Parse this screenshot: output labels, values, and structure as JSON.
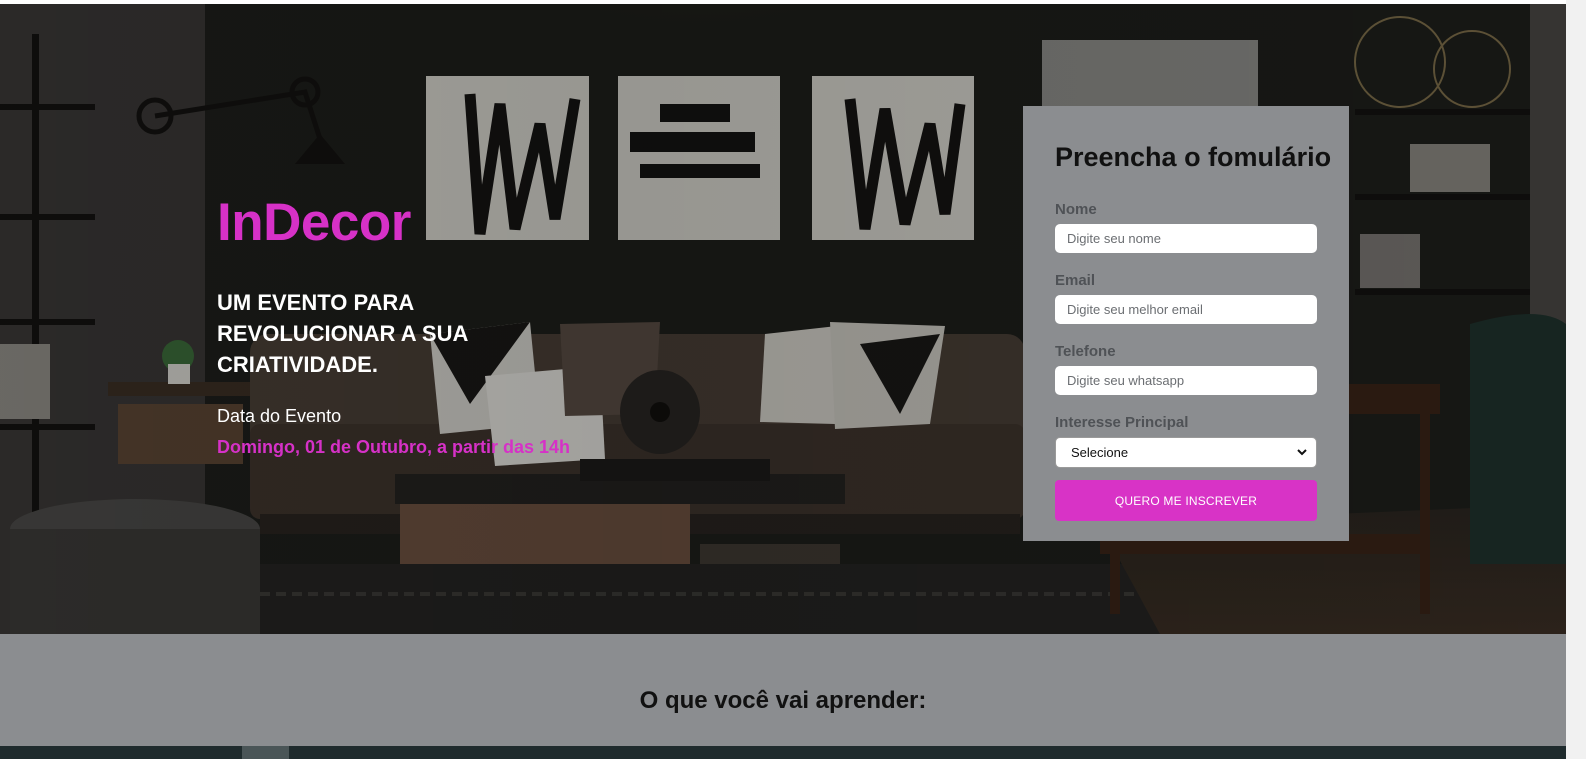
{
  "hero": {
    "brand": "InDecor",
    "headline": "UM EVENTO PARA REVOLUCIONAR A SUA CRIATIVIDADE.",
    "date_label": "Data do Evento",
    "date_value": "Domingo, 01 de Outubro, a partir das 14h"
  },
  "form": {
    "title": "Preencha o fomulário",
    "name_label": "Nome",
    "name_placeholder": "Digite seu nome",
    "email_label": "Email",
    "email_placeholder": "Digite seu melhor email",
    "phone_label": "Telefone",
    "phone_placeholder": "Digite seu whatsapp",
    "interest_label": "Interesse Principal",
    "interest_selected": "Selecione",
    "submit_label": "QUERO ME INSCREVER"
  },
  "learn": {
    "title": "O que você vai aprender:"
  },
  "colors": {
    "accent": "#d631c7",
    "panel": "#8b8d90"
  }
}
